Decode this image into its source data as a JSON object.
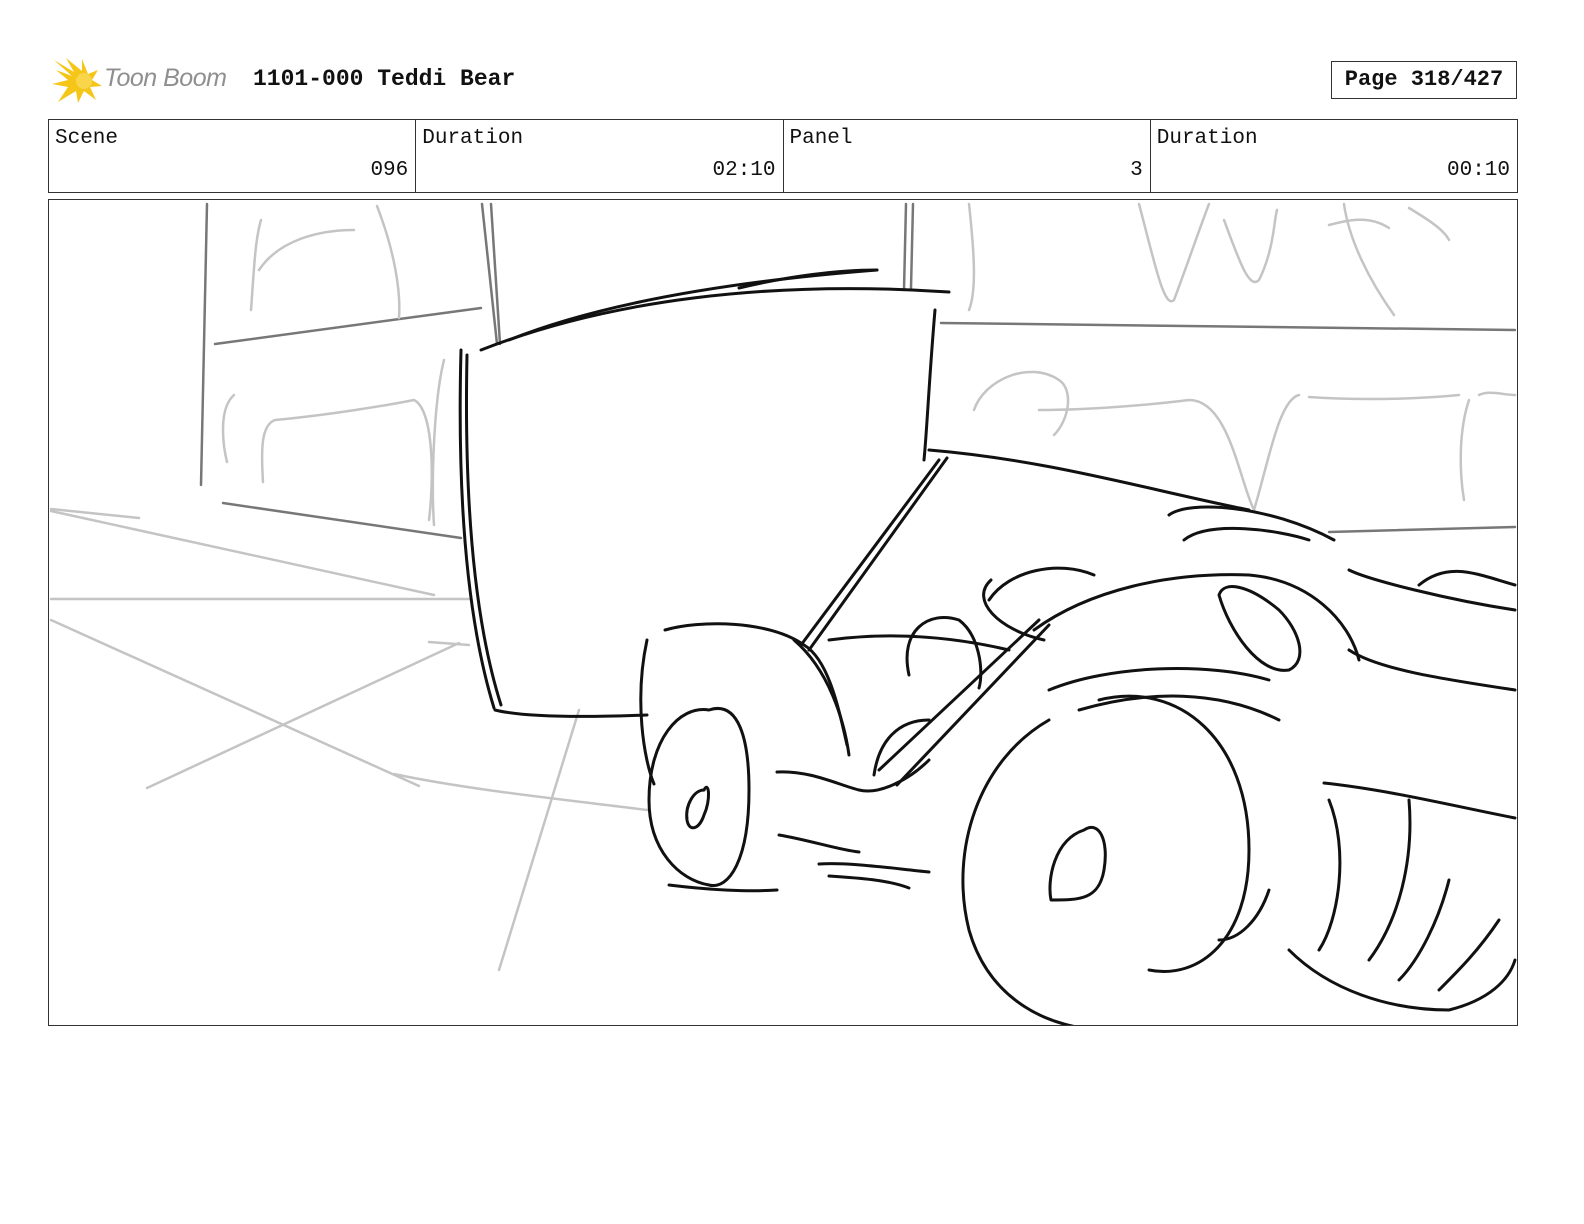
{
  "header": {
    "logo_text": "Toon Boom",
    "project_title": "1101-000 Teddi Bear",
    "page_label": "Page 318/427"
  },
  "info": {
    "scene_label": "Scene",
    "scene_value": "096",
    "scene_duration_label": "Duration",
    "scene_duration_value": "02:10",
    "panel_label": "Panel",
    "panel_value": "3",
    "panel_duration_label": "Duration",
    "panel_duration_value": "00:10"
  },
  "colors": {
    "logo_star": "#f5c518",
    "logo_text": "#8f8f8f",
    "sketch_dark": "#111111",
    "sketch_light": "#c4c4c4"
  }
}
